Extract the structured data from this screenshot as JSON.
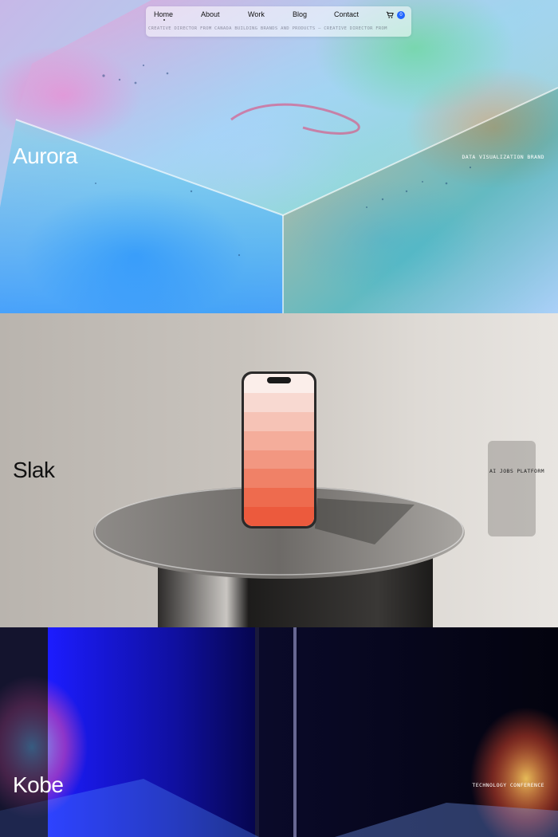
{
  "nav": {
    "links": [
      "Home",
      "About",
      "Work",
      "Blog",
      "Contact"
    ],
    "cart_count": "0",
    "ticker": "CREATIVE DIRECTOR FROM CANADA BUILDING BRANDS AND PRODUCTS —  CREATIVE DIRECTOR FROM"
  },
  "projects": [
    {
      "title": "Aurora",
      "tag": "DATA VISUALIZATION BRAND"
    },
    {
      "title": "Slak",
      "tag": "AI JOBS PLATFORM"
    },
    {
      "title": "Kobe",
      "tag": "TECHNOLOGY CONFERENCE"
    }
  ],
  "colors": {
    "accent": "#2266ff",
    "phone_gradient": [
      "#fbeeea",
      "#f8d9d1",
      "#f6c3b6",
      "#f4ad9b",
      "#f29781",
      "#f08167",
      "#ee6b4e",
      "#ec5a3d"
    ]
  }
}
